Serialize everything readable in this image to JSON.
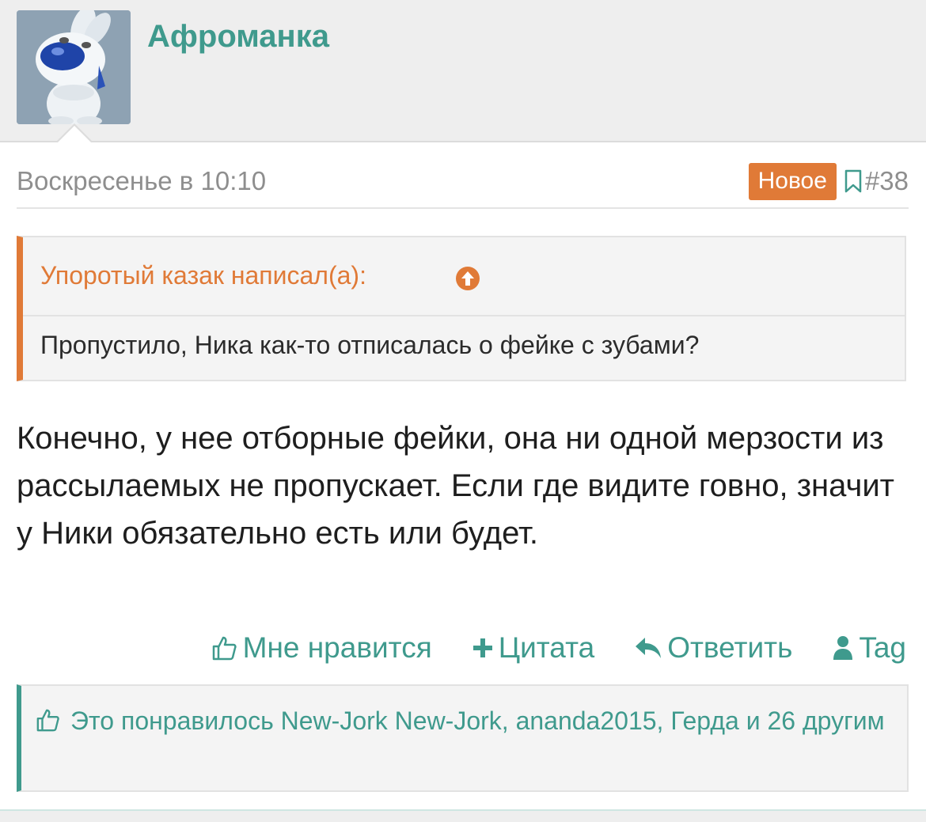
{
  "user": {
    "name": "Афроманка",
    "avatar": "bunny-avatar"
  },
  "post": {
    "date": "Воскресенье в 10:10",
    "badge": "Новое",
    "number": "#38",
    "quote": {
      "author_line": "Упоротый казак написал(а):",
      "text": "Пропустило, Ника как-то отписалась о фейке с зубами?"
    },
    "body": "Конечно, у нее отборные фейки, она ни одной мерзости из рассылаемых не пропускает. Если где видите говно, значит у Ники обязательно есть или будет."
  },
  "actions": {
    "like": "Мне нравится",
    "quote": "Цитата",
    "reply": "Ответить",
    "tag": "Tag"
  },
  "likes": {
    "text": "Это понравилось New-Jork New-Jork, ananda2015, Герда и 26 другим"
  },
  "colors": {
    "accent": "#3f9a8d",
    "orange": "#e07a37",
    "muted": "#8e8e8e"
  }
}
